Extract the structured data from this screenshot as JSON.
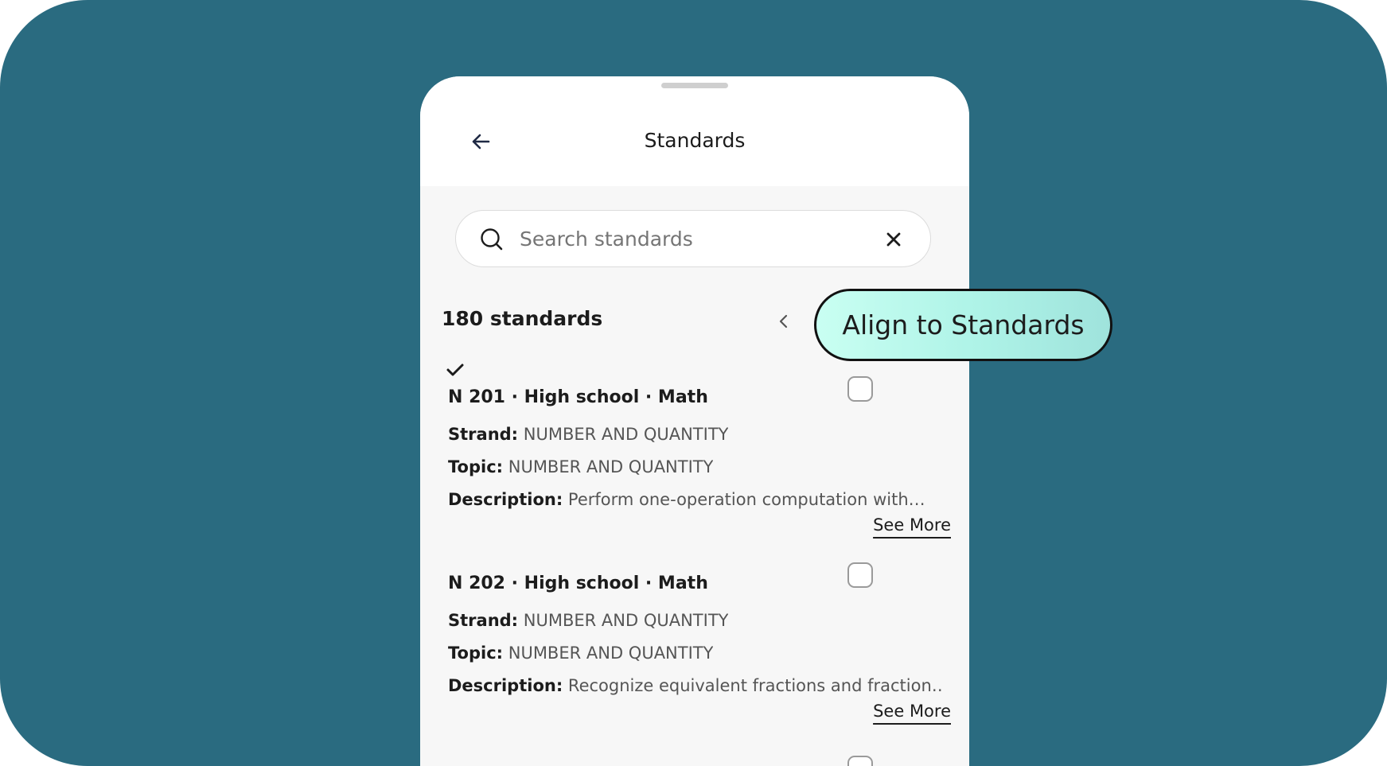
{
  "header": {
    "title": "Standards",
    "back_icon": "arrow-left-icon"
  },
  "search": {
    "value": "",
    "placeholder": "Search standards",
    "search_icon": "search-icon",
    "clear_icon": "close-icon"
  },
  "results": {
    "count_label": "180 standards"
  },
  "callout": {
    "label": "Align to Standards"
  },
  "standards": [
    {
      "title": "N 201 · High school · Math",
      "strand_label": "Strand:",
      "strand": "NUMBER AND QUANTITY",
      "topic_label": "Topic:",
      "topic": "NUMBER AND QUANTITY",
      "description_label": "Description:",
      "description": "Perform one-operation computation with…",
      "see_more": "See More",
      "checked": false
    },
    {
      "title": "N 202 · High school · Math",
      "strand_label": "Strand:",
      "strand": "NUMBER AND QUANTITY",
      "topic_label": "Topic:",
      "topic": "NUMBER AND QUANTITY",
      "description_label": "Description:",
      "description": "Recognize equivalent fractions and fraction…",
      "see_more": "See More",
      "checked": false
    }
  ],
  "colors": {
    "background": "#2a6b80",
    "sheet": "#f7f7f7",
    "callout_fill": "#b8f7eb",
    "text": "#1c1c1c"
  }
}
